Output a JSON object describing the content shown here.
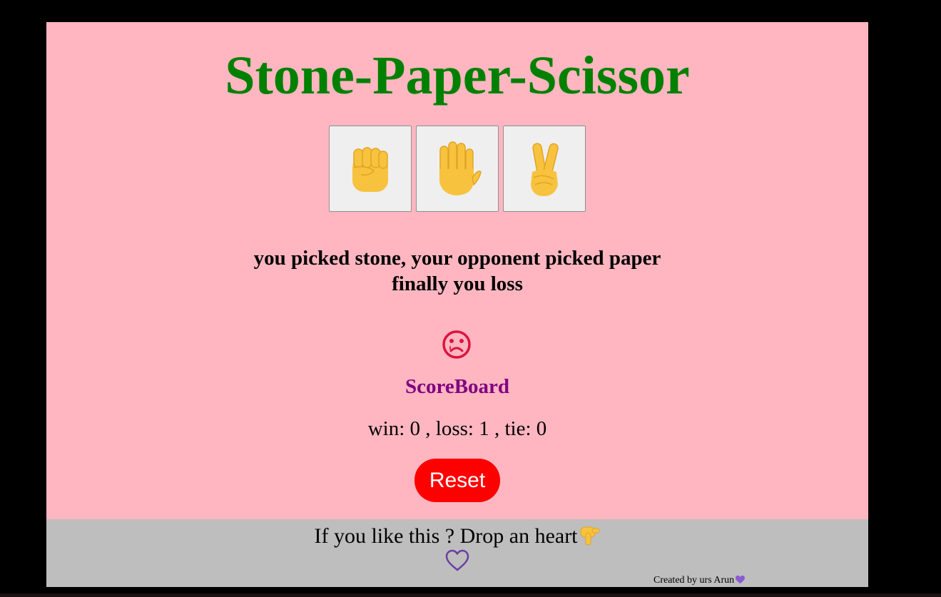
{
  "title": "Stone-Paper-Scissor",
  "choices": [
    {
      "name": "stone",
      "icon": "raised-fist-icon"
    },
    {
      "name": "paper",
      "icon": "raised-hand-icon"
    },
    {
      "name": "scissor",
      "icon": "victory-hand-icon"
    }
  ],
  "result": {
    "line1": "you picked stone, your opponent picked paper",
    "line2": "finally you loss",
    "face_icon": "sad-face-icon"
  },
  "scoreboard": {
    "title": "ScoreBoard",
    "score_text": "win: 0 , loss: 1 , tie: 0"
  },
  "reset_label": "Reset",
  "footer": {
    "text": "If you like this ? Drop an heart",
    "pointer_icon": "pointing-down-hand-icon",
    "heart_icon": "heart-outline-icon",
    "credit": "Created by urs Arun",
    "credit_icon": "purple-heart-icon"
  },
  "colors": {
    "background": "#ffb6c1",
    "title": "#008000",
    "scoreboard_title": "#800080",
    "reset_button": "#ff0000",
    "footer": "#bebebe",
    "heart": "#6a3fa0",
    "sad_face": "#dc143c"
  }
}
